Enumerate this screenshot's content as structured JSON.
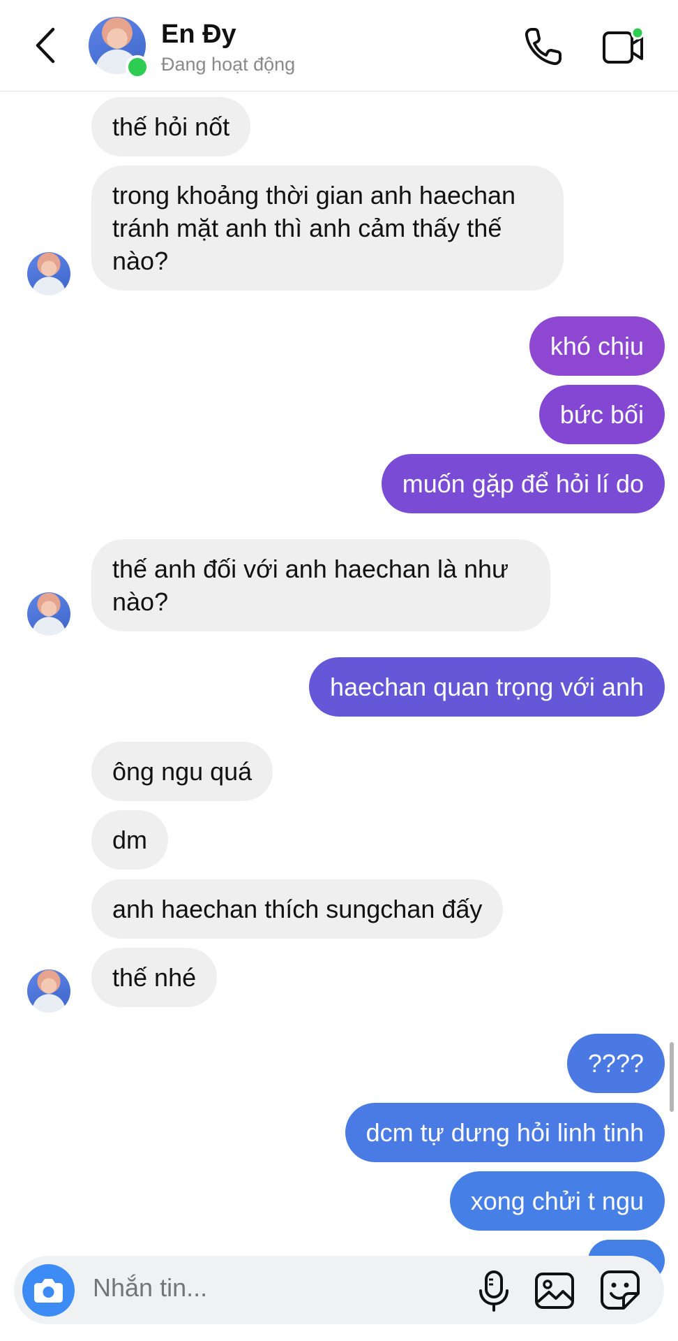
{
  "header": {
    "name": "En Đy",
    "status": "Đang hoạt động"
  },
  "messages": [
    {
      "side": "in",
      "text": "thế hỏi nốt"
    },
    {
      "side": "in",
      "text": "trong khoảng thời gian anh haechan\ntránh mặt anh thì anh cảm thấy thế\nnào?"
    },
    {
      "side": "out",
      "text": "khó chịu",
      "color": "#8e47d1"
    },
    {
      "side": "out",
      "text": "bức bối",
      "color": "#8347d3"
    },
    {
      "side": "out",
      "text": "muốn gặp để hỏi lí do",
      "color": "#7a4bd5"
    },
    {
      "side": "in",
      "text": "thế anh đối với anh haechan là như\nnào?"
    },
    {
      "side": "out",
      "text": "haechan quan trọng với anh",
      "color": "#6458d9"
    },
    {
      "side": "in",
      "text": "ông ngu quá"
    },
    {
      "side": "in",
      "text": "dm"
    },
    {
      "side": "in",
      "text": "anh haechan thích sungchan đấy"
    },
    {
      "side": "in",
      "text": "thế nhé"
    },
    {
      "side": "out",
      "text": "????",
      "color": "#4b79e3"
    },
    {
      "side": "out",
      "text": "dcm tự dưng hỏi linh tinh",
      "color": "#4a7be4"
    },
    {
      "side": "out",
      "text": "xong chửi t ngu",
      "color": "#467fe6"
    }
  ],
  "composer": {
    "placeholder": "Nhắn tin..."
  },
  "icons": {
    "back": "chevron-left-icon",
    "call": "phone-icon",
    "video": "video-camera-icon",
    "camera": "camera-icon",
    "mic": "microphone-icon",
    "gallery": "image-icon",
    "sticker": "sticker-icon"
  }
}
